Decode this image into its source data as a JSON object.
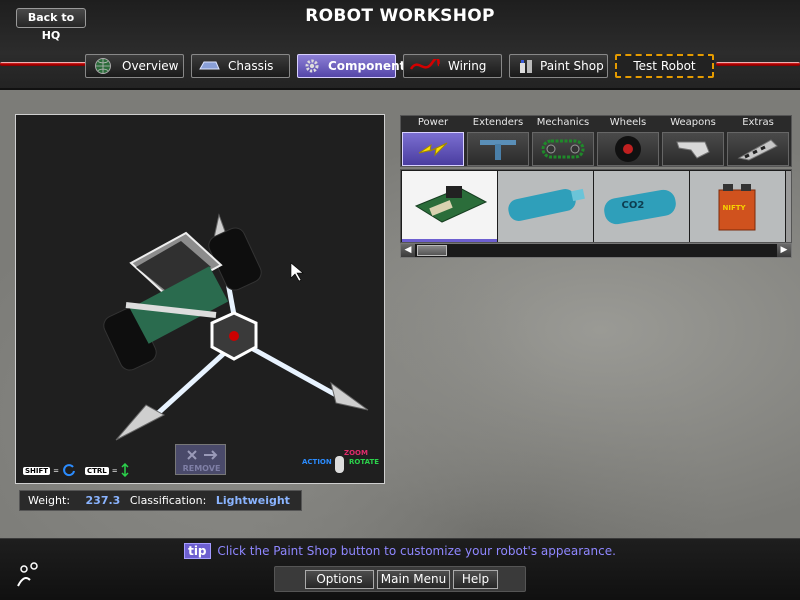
{
  "header": {
    "back_label": "Back to HQ",
    "title": "ROBOT WORKSHOP",
    "tabs": [
      {
        "label": "Overview",
        "icon": "globe-icon",
        "active": false
      },
      {
        "label": "Chassis",
        "icon": "chassis-icon",
        "active": false
      },
      {
        "label": "Components",
        "icon": "gear-icon",
        "active": true
      },
      {
        "label": "Wiring",
        "icon": "wire-icon",
        "active": false
      },
      {
        "label": "Paint Shop",
        "icon": "paint-icon",
        "active": false
      },
      {
        "label": "Test Robot",
        "icon": "",
        "active": false
      }
    ]
  },
  "viewport": {
    "controls": {
      "shift_key": "SHIFT",
      "ctrl_key": "CTRL",
      "eq": "=",
      "action": "ACTION",
      "zoom": "ZOOM",
      "rotate": "ROTATE"
    },
    "remove_label": "REMOVE"
  },
  "stats": {
    "weight_label": "Weight:",
    "weight_value": "237.3",
    "class_label": "Classification:",
    "class_value": "Lightweight"
  },
  "components": {
    "categories": [
      {
        "label": "Power",
        "icon": "lightning-icon",
        "selected": true
      },
      {
        "label": "Extenders",
        "icon": "extender-icon",
        "selected": false
      },
      {
        "label": "Mechanics",
        "icon": "chain-icon",
        "selected": false
      },
      {
        "label": "Wheels",
        "icon": "wheel-icon",
        "selected": false
      },
      {
        "label": "Weapons",
        "icon": "blade-icon",
        "selected": false
      },
      {
        "label": "Extras",
        "icon": "wedge-icon",
        "selected": false
      }
    ],
    "items": [
      {
        "icon": "circuit-board-icon",
        "selected": true
      },
      {
        "icon": "battery-cylinder-icon",
        "selected": false
      },
      {
        "icon": "co2-tank-icon",
        "selected": false,
        "text": "CO2"
      },
      {
        "icon": "battery-box-icon",
        "selected": false,
        "text": "NIFTY"
      }
    ]
  },
  "footer": {
    "tip_tag": "tip",
    "tip_text": "Click the Paint Shop button to customize your robot's appearance.",
    "buttons": [
      "Options",
      "Main Menu",
      "Help"
    ]
  },
  "colors": {
    "accent": "#6d5fd0",
    "value": "#8ab4ff",
    "warning": "#e59b00",
    "wire": "#c40000"
  }
}
